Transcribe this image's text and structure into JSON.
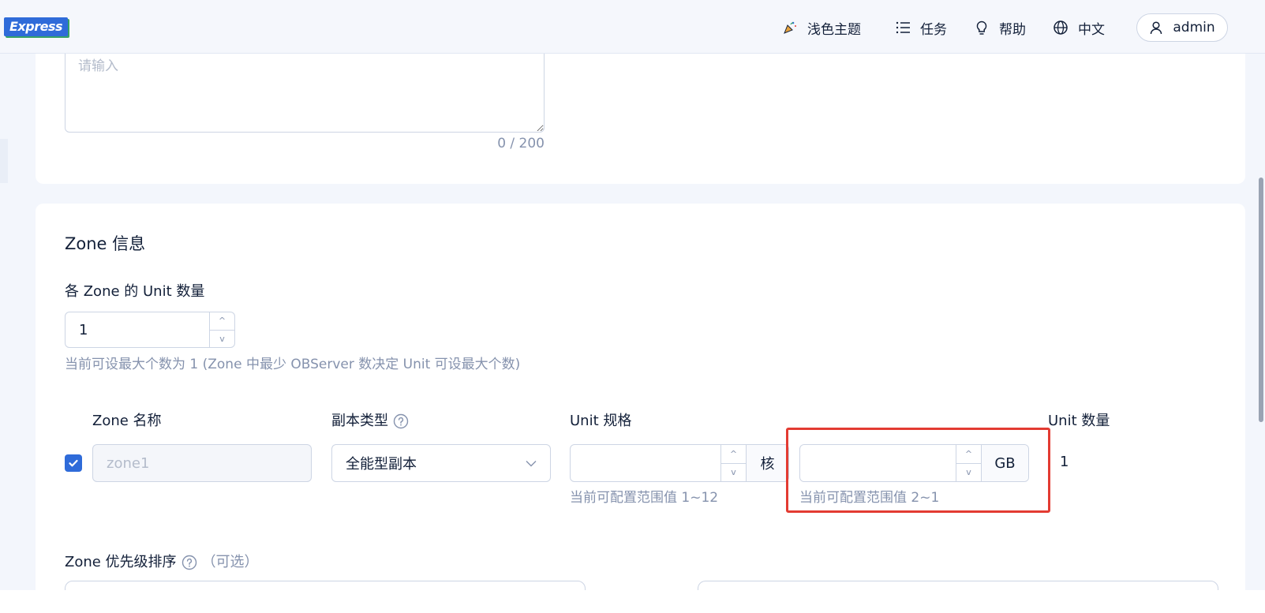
{
  "header": {
    "logo_text": "Express",
    "theme_label": "浅色主题",
    "tasks_label": "任务",
    "help_label": "帮助",
    "language_label": "中文",
    "user_label": "admin"
  },
  "description": {
    "placeholder": "请输入",
    "counter": "0 / 200"
  },
  "zone_section": {
    "title": "Zone 信息",
    "unit_count_label": "各 Zone 的 Unit 数量",
    "unit_count_value": "1",
    "unit_count_hint": "当前可设最大个数为 1 (Zone 中最少 OBServer 数决定 Unit 可设最大个数)",
    "columns": {
      "zone_name": "Zone 名称",
      "replica_type": "副本类型",
      "unit_spec": "Unit 规格",
      "unit_count": "Unit 数量"
    },
    "row": {
      "checked": true,
      "zone_name_placeholder": "zone1",
      "replica_type_value": "全能型副本",
      "cpu_value": "",
      "cpu_unit": "核",
      "cpu_hint": "当前可配置范围值 1~12",
      "memory_value": "",
      "memory_unit": "GB",
      "memory_hint": "当前可配置范围值 2~1",
      "unit_count_value": "1"
    },
    "priority_label": "Zone 优先级排序",
    "priority_optional": "（可选）"
  },
  "colors": {
    "primary": "#2f6bd9",
    "highlight_border": "#e33b32",
    "hint_text": "#8592ad"
  },
  "icons": [
    "party-icon",
    "list-icon",
    "bulb-icon",
    "globe-icon",
    "user-icon",
    "question-icon",
    "chevron-down-icon",
    "check-icon"
  ]
}
